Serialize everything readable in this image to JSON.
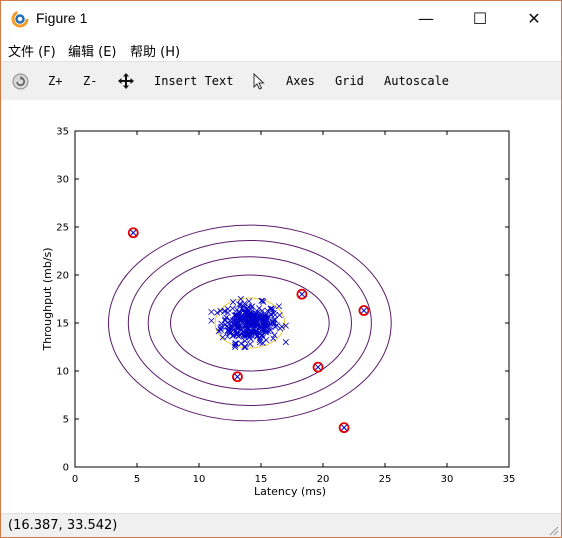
{
  "window": {
    "title": "Figure 1",
    "controls": {
      "minimize": "—",
      "maximize": "☐",
      "close": "✕"
    },
    "icon": "octave-logo-icon"
  },
  "menu": [
    {
      "label": "文件 (F)"
    },
    {
      "label": "编辑 (E)"
    },
    {
      "label": "帮助 (H)"
    }
  ],
  "toolbar": {
    "rotate_icon": "rotate-icon",
    "zoom_in": "Z+",
    "zoom_out": "Z-",
    "pan_icon": "pan-arrows-icon",
    "insert_text": "Insert Text",
    "select_icon": "pointer-icon",
    "axes": "Axes",
    "grid": "Grid",
    "autoscale": "Autoscale"
  },
  "status": {
    "coords": "(16.387, 33.542)"
  },
  "colors": {
    "contour_outer": "#5a1a6b",
    "contour_inner": "#e8c830",
    "data_points": "#0000cc",
    "anomaly": "#e00000"
  },
  "chart_data": {
    "type": "scatter",
    "title": "",
    "xlabel": "Latency (ms)",
    "ylabel": "Throughput (mb/s)",
    "xlim": [
      0,
      35
    ],
    "ylim": [
      0,
      35
    ],
    "xticks": [
      0,
      5,
      10,
      15,
      20,
      25,
      30,
      35
    ],
    "yticks": [
      0,
      5,
      10,
      15,
      20,
      25,
      30,
      35
    ],
    "grid": false,
    "center": [
      14.1,
      15.0
    ],
    "cluster": {
      "marker": "x",
      "approx_count": 300,
      "x_range": [
        11.0,
        17.0
      ],
      "y_range": [
        12.5,
        18.0
      ]
    },
    "contours": [
      {
        "level": "outer",
        "rx": 11.4,
        "ry": 10.2
      },
      {
        "level": "outer",
        "rx": 9.8,
        "ry": 8.6
      },
      {
        "level": "outer",
        "rx": 8.2,
        "ry": 6.9
      },
      {
        "level": "outer",
        "rx": 6.4,
        "ry": 5.0
      },
      {
        "level": "inner",
        "rx": 2.8,
        "ry": 2.6
      }
    ],
    "anomalies": [
      [
        4.7,
        24.4
      ],
      [
        13.1,
        9.4
      ],
      [
        18.3,
        18.0
      ],
      [
        19.6,
        10.4
      ],
      [
        21.7,
        4.1
      ],
      [
        23.3,
        16.3
      ]
    ]
  }
}
